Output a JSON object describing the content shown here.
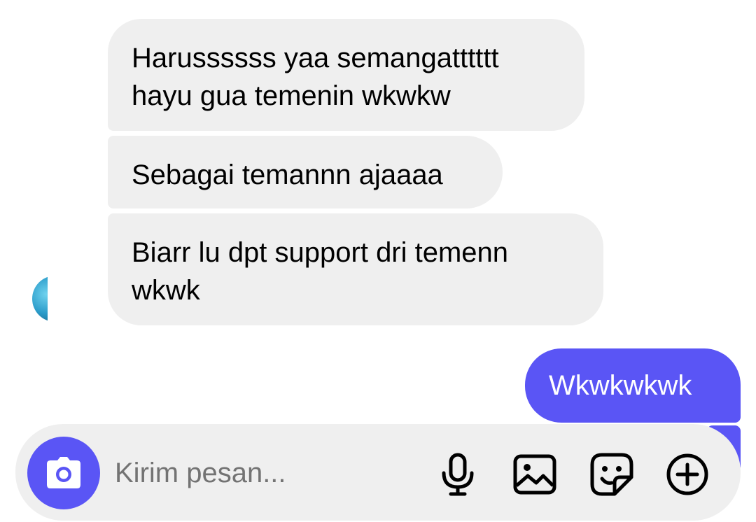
{
  "conversation": {
    "incoming": [
      {
        "lines": [
          "Harussssss yaa semangatttttt",
          "hayu gua temenin wkwkw"
        ]
      },
      {
        "lines": [
          "Sebagai temannn ajaaaa"
        ]
      },
      {
        "lines": [
          "Biarr lu dpt support dri temenn",
          "wkwk"
        ]
      }
    ],
    "outgoing": [
      {
        "text": "Wkwkwkwk"
      }
    ]
  },
  "composer": {
    "placeholder": "Kirim pesan...",
    "icons": [
      "camera-icon",
      "microphone-icon",
      "photo-icon",
      "sticker-icon",
      "plus-icon"
    ]
  },
  "colors": {
    "accent": "#5a55f5",
    "incoming_bubble": "#efefef",
    "composer_bg": "#efefef",
    "placeholder": "#737373"
  }
}
